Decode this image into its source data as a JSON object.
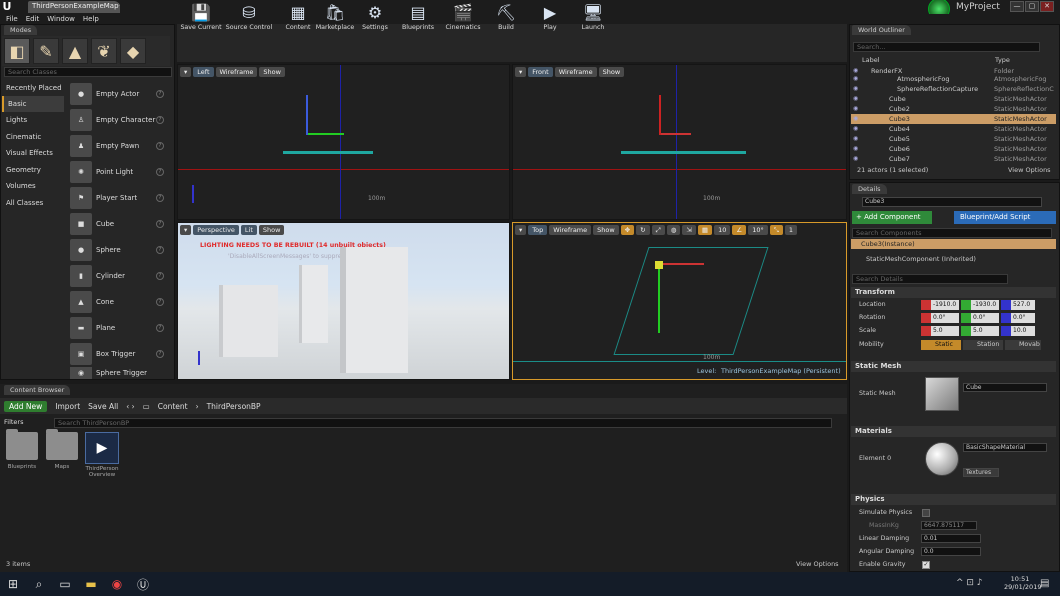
{
  "title_bar": {
    "doc_tab": "ThirdPersonExampleMap*",
    "project": "MyProject",
    "min": "—",
    "max": "▢",
    "close": "✕"
  },
  "menu": [
    "File",
    "Edit",
    "Window",
    "Help"
  ],
  "modes": {
    "tab": "Modes",
    "search_placeholder": "Search Classes",
    "categories": [
      "Recently Placed",
      "Basic",
      "Lights",
      "Cinematic",
      "Visual Effects",
      "Geometry",
      "Volumes",
      "All Classes"
    ],
    "items": [
      "Empty Actor",
      "Empty Character",
      "Empty Pawn",
      "Point Light",
      "Player Start",
      "Cube",
      "Sphere",
      "Cylinder",
      "Cone",
      "Plane",
      "Box Trigger",
      "Sphere Trigger"
    ]
  },
  "toolbar": [
    "Save Current",
    "Source Control",
    "Content",
    "Marketplace",
    "Settings",
    "Blueprints",
    "Cinematics",
    "Build",
    "Play",
    "Launch"
  ],
  "viewports": {
    "left": {
      "view": "Left",
      "mode": "Wireframe",
      "show": "Show",
      "scale": "100m"
    },
    "front": {
      "view": "Front",
      "mode": "Wireframe",
      "show": "Show",
      "scale": "100m"
    },
    "persp": {
      "view": "Perspective",
      "mode": "Lit",
      "show": "Show",
      "warning": "LIGHTING NEEDS TO BE REBUILT (14 unbuilt objects)",
      "sub": "'DisableAllScreenMessages' to suppress"
    },
    "top": {
      "view": "Top",
      "mode": "Wireframe",
      "show": "Show",
      "snap1": "10",
      "snap2": "10°",
      "snap3": "1",
      "scale": "100m",
      "level_label": "Level:",
      "level_name": "ThirdPersonExampleMap (Persistent)"
    }
  },
  "content_browser": {
    "tab": "Content Browser",
    "add_new": "Add New",
    "import": "Import",
    "save_all": "Save All",
    "path": [
      "Content",
      "ThirdPersonBP"
    ],
    "filters": "Filters",
    "search_placeholder": "Search ThirdPersonBP",
    "assets": [
      "Blueprints",
      "Maps",
      "ThirdPerson Overview"
    ],
    "count": "3 items",
    "view_options": "View Options"
  },
  "world_outliner": {
    "tab": "World Outliner",
    "search_placeholder": "Search...",
    "col_label": "Label",
    "col_type": "Type",
    "rows": [
      {
        "l": "RenderFX",
        "t": "Folder"
      },
      {
        "l": "AtmosphericFog",
        "t": "AtmosphericFog"
      },
      {
        "l": "SphereReflectionCapture",
        "t": "SphereReflectionC"
      },
      {
        "l": "Cube",
        "t": "StaticMeshActor"
      },
      {
        "l": "Cube2",
        "t": "StaticMeshActor"
      },
      {
        "l": "Cube3",
        "t": "StaticMeshActor"
      },
      {
        "l": "Cube4",
        "t": "StaticMeshActor"
      },
      {
        "l": "Cube5",
        "t": "StaticMeshActor"
      },
      {
        "l": "Cube6",
        "t": "StaticMeshActor"
      },
      {
        "l": "Cube7",
        "t": "StaticMeshActor"
      }
    ],
    "summary": "21 actors (1 selected)",
    "view_options": "View Options"
  },
  "details": {
    "tab": "Details",
    "name": "Cube3",
    "add_component": "+ Add Component",
    "blueprint": "Blueprint/Add Script",
    "search_components": "Search Components",
    "comp_instance": "Cube3(Instance)",
    "comp_inherited": "StaticMeshComponent (Inherited)",
    "search_details": "Search Details",
    "transform": {
      "title": "Transform",
      "location_label": "Location",
      "location": [
        "-1910.0",
        "-1930.0",
        "527.0"
      ],
      "rotation_label": "Rotation",
      "rotation": [
        "0.0°",
        "0.0°",
        "0.0°"
      ],
      "scale_label": "Scale",
      "scale": [
        "5.0",
        "5.0",
        "10.0"
      ],
      "mobility_label": "Mobility",
      "mobility": [
        "Static",
        "Station",
        "Movab"
      ]
    },
    "static_mesh": {
      "title": "Static Mesh",
      "label": "Static Mesh",
      "value": "Cube"
    },
    "materials": {
      "title": "Materials",
      "label": "Element 0",
      "value": "BasicShapeMaterial",
      "textures": "Textures"
    },
    "physics": {
      "title": "Physics",
      "simulate": "Simulate Physics",
      "mass_label": "MassInKg",
      "mass": "6647.875117",
      "lin_label": "Linear Damping",
      "lin": "0.01",
      "ang_label": "Angular Damping",
      "ang": "0.0",
      "grav": "Enable Gravity"
    }
  },
  "taskbar": {
    "time": "10:51",
    "date": "29/01/2019"
  }
}
